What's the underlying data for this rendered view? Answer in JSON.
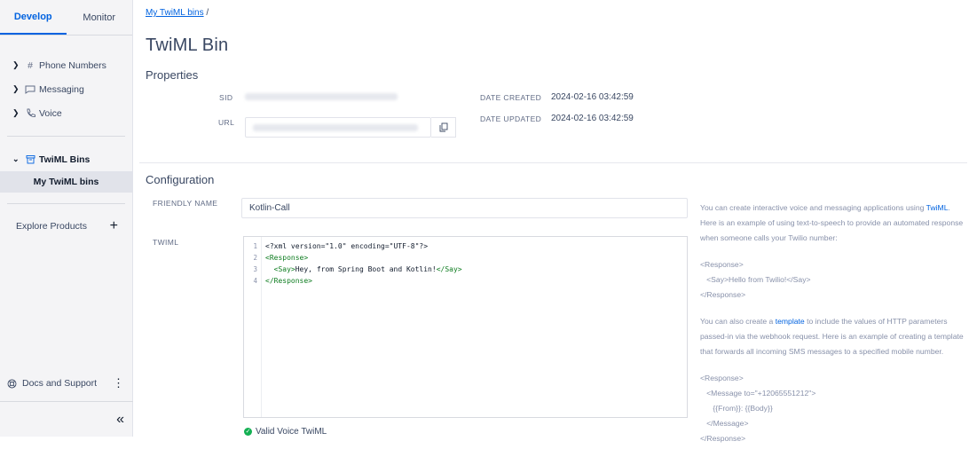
{
  "sidebar": {
    "tabs": [
      {
        "label": "Develop",
        "active": true
      },
      {
        "label": "Monitor",
        "active": false
      }
    ],
    "nav": [
      {
        "label": "Phone Numbers",
        "icon": "hash-icon"
      },
      {
        "label": "Messaging",
        "icon": "chat-icon"
      },
      {
        "label": "Voice",
        "icon": "phone-icon"
      }
    ],
    "twiml_bins": {
      "label": "TwiML Bins",
      "icon": "bin-icon"
    },
    "my_twiml_bins": "My TwiML bins",
    "explore": {
      "label": "Explore Products",
      "plus": "+"
    },
    "docs": {
      "label": "Docs and Support",
      "menu": "⋮"
    },
    "collapse": "«"
  },
  "breadcrumb": {
    "link": "My TwiML bins",
    "sep": "/"
  },
  "page_title": "TwiML Bin",
  "properties": {
    "title": "Properties",
    "sid_label": "SID",
    "url_label": "URL",
    "date_created_label": "DATE CREATED",
    "date_created": "2024-02-16 03:42:59",
    "date_updated_label": "DATE UPDATED",
    "date_updated": "2024-02-16 03:42:59"
  },
  "configuration": {
    "title": "Configuration",
    "friendly_name_label": "FRIENDLY NAME",
    "friendly_name": "Kotlin-Call",
    "twiml_label": "TWIML",
    "line_numbers": [
      "1",
      "2",
      "3",
      "4"
    ],
    "code": {
      "l1": "<?xml version=\"1.0\" encoding=\"UTF-8\"?>",
      "l2_tag": "<Response>",
      "l3_indent": "  ",
      "l3_open": "<Say>",
      "l3_text": "Hey, from Spring Boot and Kotlin!",
      "l3_close": "</Say>",
      "l4_tag": "</Response>"
    },
    "valid_text": "Valid Voice TwiML"
  },
  "help": {
    "p1_a": "You can create interactive voice and messaging applications using ",
    "p1_link": "TwiML",
    "p1_b": ". Here is an example of using text-to-speech to provide an automated response when someone calls your Twilio number:",
    "ex1": [
      "<Response>",
      "   <Say>Hello from Twilio!</Say>",
      "</Response>"
    ],
    "p2_a": "You can also create a ",
    "p2_link": "template",
    "p2_b": " to include the values of HTTP parameters passed-in via the webhook request. Here is an example of creating a template that forwards all incoming SMS messages to a specified mobile number.",
    "ex2": [
      "<Response>",
      "   <Message to=\"+12065551212\">",
      "      {{From}}: {{Body}}",
      "   </Message>",
      "</Response>"
    ]
  }
}
